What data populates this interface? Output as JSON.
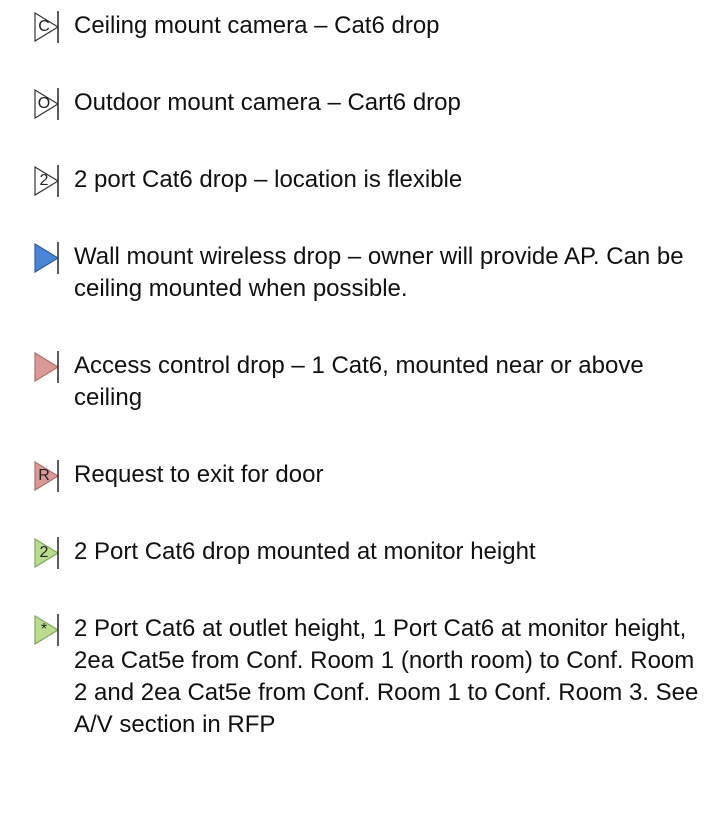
{
  "legend": {
    "items": [
      {
        "symbol_letter": "C",
        "fill": "#ffffff",
        "text": "Ceiling mount camera – Cat6 drop"
      },
      {
        "symbol_letter": "O",
        "fill": "#ffffff",
        "text": "Outdoor mount camera – Cart6 drop"
      },
      {
        "symbol_letter": "2",
        "fill": "#ffffff",
        "text": "2 port Cat6 drop – location is flexible"
      },
      {
        "symbol_letter": "",
        "fill": "#4a86d8",
        "text": "Wall mount wireless drop – owner will provide AP.  Can be ceiling mounted when possible."
      },
      {
        "symbol_letter": "",
        "fill": "#d99a96",
        "text": "Access control drop – 1 Cat6, mounted near or above ceiling"
      },
      {
        "symbol_letter": "R",
        "fill": "#d99a96",
        "text": "Request to exit for door"
      },
      {
        "symbol_letter": "2",
        "fill": "#b9dc8f",
        "text": "2 Port Cat6 drop mounted at monitor height"
      },
      {
        "symbol_letter": "*",
        "fill": "#b9dc8f",
        "text": "2 Port Cat6 at outlet height, 1 Port Cat6 at monitor height, 2ea Cat5e from Conf. Room 1 (north room) to Conf. Room 2 and 2ea Cat5e from Conf. Room 1 to Conf. Room 3.  See A/V section in RFP"
      }
    ]
  }
}
